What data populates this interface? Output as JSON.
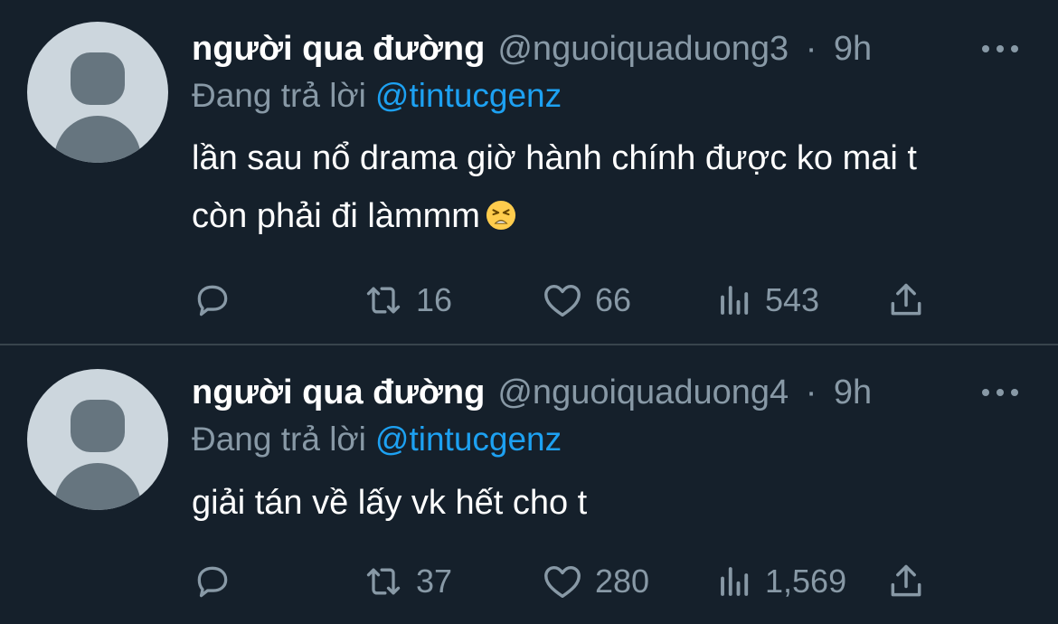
{
  "tweets": [
    {
      "name": "người qua đường",
      "handle": "@nguoiquaduong3",
      "sep": "·",
      "time": "9h",
      "replying_prefix": "Đang trả lời",
      "replying_to": "@tintucgenz",
      "text_line1": "lần sau nổ drama giờ hành chính được ko mai t",
      "text_line2": "còn phải đi làmmm",
      "emoji": "tired-face-emoji",
      "retweets": "16",
      "likes": "66",
      "views": "543"
    },
    {
      "name": "người qua đường",
      "handle": "@nguoiquaduong4",
      "sep": "·",
      "time": "9h",
      "replying_prefix": "Đang trả lời",
      "replying_to": "@tintucgenz",
      "text_line1": "giải tán về lấy vk hết cho t",
      "retweets": "37",
      "likes": "280",
      "views": "1,569"
    }
  ],
  "icons": {
    "reply": "reply-icon",
    "retweet": "retweet-icon",
    "like": "heart-icon",
    "views": "views-icon",
    "share": "share-icon",
    "more": "more-icon"
  },
  "colors": {
    "background": "#15202b",
    "secondary_text": "#8899a6",
    "accent": "#1da1f2",
    "divider": "#38444d"
  }
}
